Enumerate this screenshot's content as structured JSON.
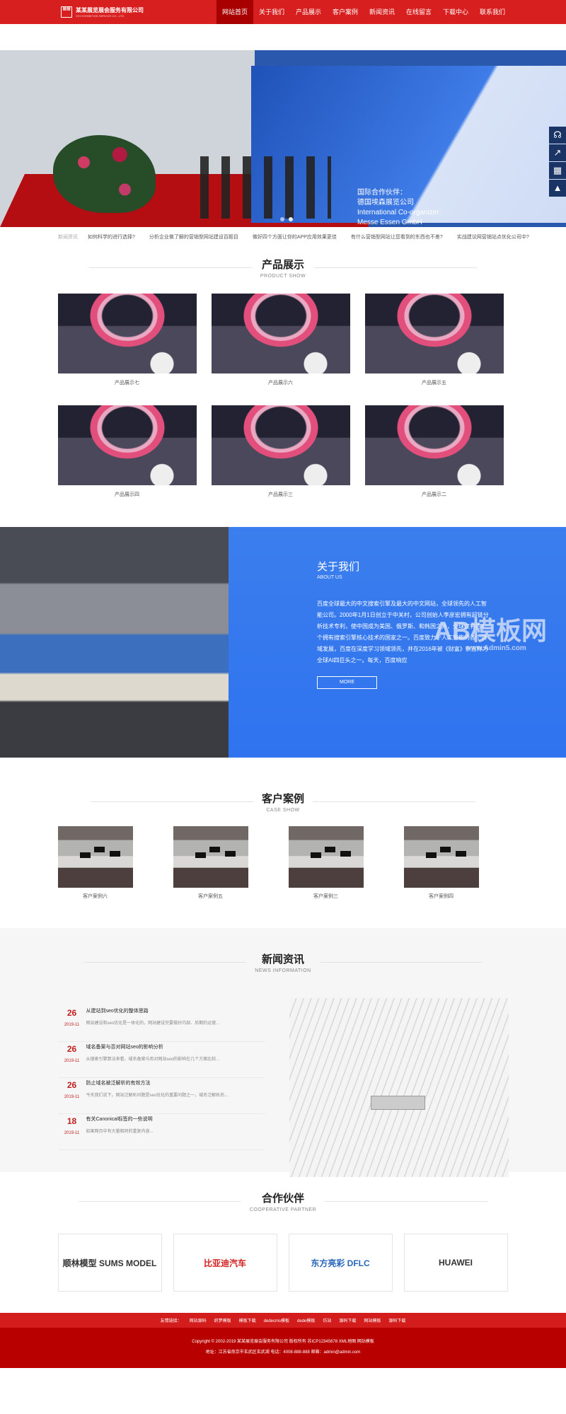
{
  "header": {
    "logo": "某某展览展会服务有限公司",
    "logo_sub": "XXX EXHIBITION SERVICE CO., LTD.",
    "nav": [
      "网站首页",
      "关于我们",
      "产品展示",
      "客户案例",
      "新闻资讯",
      "在线留言",
      "下载中心",
      "联系我们"
    ]
  },
  "hero": {
    "text1": "国际合作伙伴：",
    "text2": "德国埃森展览公司",
    "text3": "International Co-organizer:",
    "text4": "Messe Essen GmbH"
  },
  "news_strip": {
    "label": "新闻资讯",
    "items": [
      "如何科学的进行选择?",
      "分析企业做了解的营销型网站建设百题目",
      "做好四个方面让你的APP应用效果更佳",
      "有什么营销型网站让您看到的东西也不差?",
      "实战建议网营销站点优化公司中?"
    ]
  },
  "products": {
    "title": "产品展示",
    "subtitle": "PRODUCT SHOW",
    "items": [
      "产品展示七",
      "产品展示六",
      "产品展示五",
      "产品展示四",
      "产品展示三",
      "产品展示二"
    ]
  },
  "about": {
    "title": "关于我们",
    "subtitle": "ABOUT US",
    "body": "百度全球最大的中文搜索引擎及最大的中文网站，全球领先的人工智能公司。2000年1月1日创立于中关村，公司创始人李彦宏拥有超链分析技术专利，使中国成为美国、俄罗斯、和韩国之外，全球仅有的4个拥有搜索引擎核心技术的国家之一。百度致力于人工智能的各个领域发展，百度在深度学习领域领先，并在2016年被《财富》杂志称为全球AI四巨头之一。每天，百度响应",
    "button": "MORE",
    "watermark": "AB模板网",
    "watermark_url": "www.Admin5.com"
  },
  "cases": {
    "title": "客户案例",
    "subtitle": "CASE SHOW",
    "items": [
      "客户案例六",
      "客户案例五",
      "客户案例三",
      "客户案例四"
    ]
  },
  "news": {
    "title": "新闻资讯",
    "subtitle": "NEWS INFORMATION",
    "items": [
      {
        "day": "26",
        "date": "2019-11",
        "title": "从建站到seo优化的整体思路",
        "summary": "网站建设和seo优化是一体化的，网站建设完要做好内部、后期的运营..."
      },
      {
        "day": "26",
        "date": "2019-11",
        "title": "域名备案与否对网站seo的影响分析",
        "summary": "从搜索引擎算法来看，域名备案与否对网站seo的影响在几个方面比较..."
      },
      {
        "day": "26",
        "date": "2019-11",
        "title": "防止域名被泛解析的有效方法",
        "summary": "今天我们说下，网站泛解析问题是seo优化的重要问题之一，域名泛解析后..."
      },
      {
        "day": "18",
        "date": "2019-11",
        "title": "有关Canonical标签的一些说明",
        "summary": "如果网页中有大量相同的重复内容..."
      }
    ]
  },
  "partners": {
    "title": "合作伙伴",
    "subtitle": "COOPERATIVE PARTNER",
    "items": [
      "顺林模型 SUMS MODEL",
      "比亚迪汽车",
      "东方亮彩 DFLC",
      "HUAWEI"
    ]
  },
  "footer": {
    "links": [
      "友情链接：",
      "网站源码",
      "织梦模板",
      "模板下载",
      "dedecms模板",
      "dede模板",
      "仿站",
      "源码下载",
      "网站模板",
      "源码下载"
    ],
    "copyright": "Copyright © 2002-2019 某某展览展会服务有限公司 版权所有  苏ICP12345678  XML地图  网站模板",
    "contact": "地址：江苏省南京市玄武区玄武湖  电话：4008-888-888  邮箱：admin@admin.com"
  }
}
